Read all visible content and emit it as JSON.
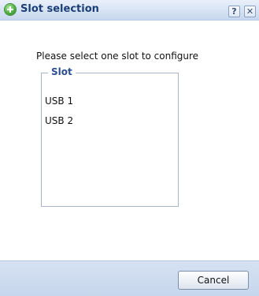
{
  "dialog": {
    "title": "Slot selection",
    "title_icon": "add-icon",
    "help_label": "?",
    "close_label": "✕",
    "prompt": "Please select one slot to configure"
  },
  "slot_group": {
    "legend": "Slot",
    "items": [
      {
        "label": "USB 1"
      },
      {
        "label": "USB 2"
      }
    ]
  },
  "footer": {
    "cancel_label": "Cancel"
  },
  "colors": {
    "title_text": "#1b3f7a",
    "legend_text": "#2a4f95",
    "titlebar_bg": "#d7e3f4",
    "footer_bg": "#c6d6ec"
  }
}
